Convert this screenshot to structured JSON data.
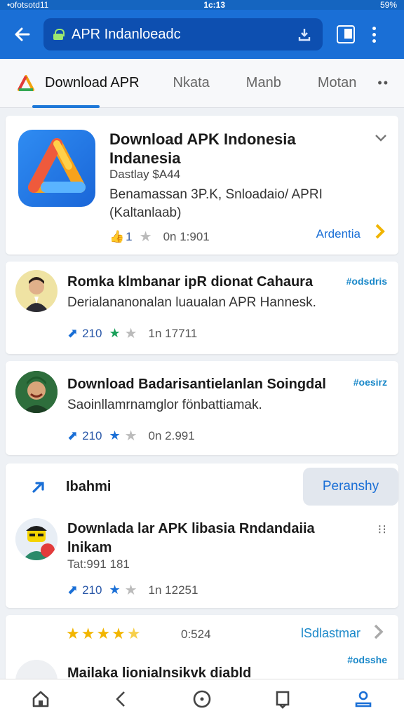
{
  "status_bar": {
    "left": "•ofotsotd11",
    "time": "1c:13",
    "right": "59%"
  },
  "browser": {
    "url": "APR Indanloeadc"
  },
  "tabs": [
    {
      "label": "Download APR",
      "active": true
    },
    {
      "label": "Nkata"
    },
    {
      "label": "Manb"
    },
    {
      "label": "Motan"
    }
  ],
  "featured": {
    "title": "Download APK Indonesia Indanesia",
    "subtitle": "Dastlay $A44",
    "description": "Benamassan 3P.K, Snloadaio/ APRI (Kaltanlaab)",
    "likes": "1",
    "time": "0n 1:901",
    "link": "Ardentia"
  },
  "posts": [
    {
      "title": "Romka klmbanar ipR dionat Cahaura",
      "tag": "#odsdris",
      "description": "Derialananonalan luaualan APR Hannesk.",
      "count": "210",
      "time": "1n 17711"
    },
    {
      "title": "Download Badarisantielanlan Soingdal",
      "tag": "#oesirz",
      "description": "Saoinllamrnamglor fönbattiamak.",
      "count": "210",
      "time": "0n 2.991"
    }
  ],
  "section": {
    "header": "Ibahmi",
    "button": "Peranshy",
    "post": {
      "title": "Downlada lar APK libasia Rndandaiia lnikam",
      "time_line": "Tat:991 181",
      "count": "210",
      "time": "1n 12251"
    }
  },
  "rated": {
    "rating": 4.5,
    "time": "0:524",
    "link": "lSdlastmar",
    "tag": "#odsshe",
    "title": "Mailaka lionialnsikvk diabld"
  }
}
